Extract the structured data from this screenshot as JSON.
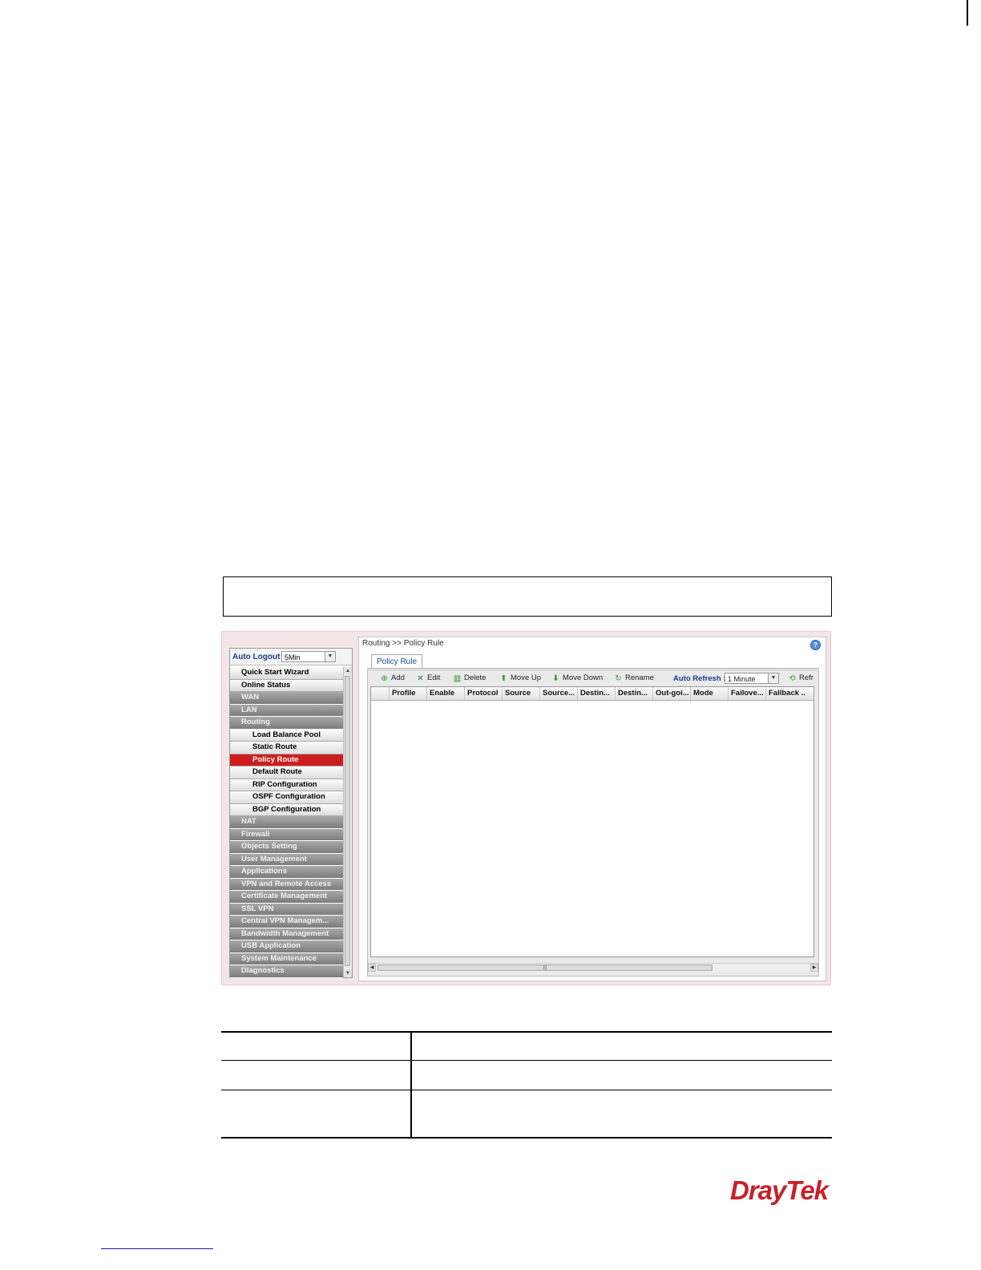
{
  "auto_logout": {
    "label": "Auto Logout :",
    "value": "5Min"
  },
  "menu": [
    {
      "label": "Quick Start Wizard",
      "kind": "top"
    },
    {
      "label": "Online Status",
      "kind": "top"
    },
    {
      "label": "WAN",
      "kind": "grp"
    },
    {
      "label": "LAN",
      "kind": "grp"
    },
    {
      "label": "Routing",
      "kind": "grp"
    },
    {
      "label": "Load Balance Pool",
      "kind": "sub"
    },
    {
      "label": "Static Route",
      "kind": "sub"
    },
    {
      "label": "Policy Route",
      "kind": "sub",
      "active": true
    },
    {
      "label": "Default Route",
      "kind": "sub"
    },
    {
      "label": "RIP Configuration",
      "kind": "sub"
    },
    {
      "label": "OSPF Configuration",
      "kind": "sub"
    },
    {
      "label": "BGP Configuration",
      "kind": "sub"
    },
    {
      "label": "NAT",
      "kind": "grp"
    },
    {
      "label": "Firewall",
      "kind": "grp"
    },
    {
      "label": "Objects Setting",
      "kind": "grp"
    },
    {
      "label": "User Management",
      "kind": "grp"
    },
    {
      "label": "Applications",
      "kind": "grp"
    },
    {
      "label": "VPN and Remote Access",
      "kind": "grp"
    },
    {
      "label": "Certificate Management",
      "kind": "grp"
    },
    {
      "label": "SSL VPN",
      "kind": "grp"
    },
    {
      "label": "Central VPN Managem...",
      "kind": "grp"
    },
    {
      "label": "Bandwidth Management",
      "kind": "grp"
    },
    {
      "label": "USB Application",
      "kind": "grp"
    },
    {
      "label": "System Maintenance",
      "kind": "grp"
    },
    {
      "label": "Diagnostics",
      "kind": "grp"
    }
  ],
  "breadcrumb": "Routing >> Policy Rule",
  "tab": "Policy Rule",
  "toolbar": {
    "add": "Add",
    "edit": "Edit",
    "delete": "Delete",
    "move_up": "Move Up",
    "move_down": "Move Down",
    "rename": "Rename",
    "auto_refresh_label": "Auto Refresh :",
    "auto_refresh_value": "1 Minute",
    "refresh": "Refr"
  },
  "columns": [
    "",
    "Profile",
    "Enable",
    "Protocol",
    "Source",
    "Source...",
    "Destin...",
    "Destin...",
    "Out-goi...",
    "Mode",
    "Failove...",
    "Fallback ..."
  ],
  "logo": "DrayTek",
  "colors": {
    "active_item": "#cc1e1e",
    "group_item": "#8a8a8a",
    "logo": "#c8202a",
    "link": "#1b4aa0"
  }
}
